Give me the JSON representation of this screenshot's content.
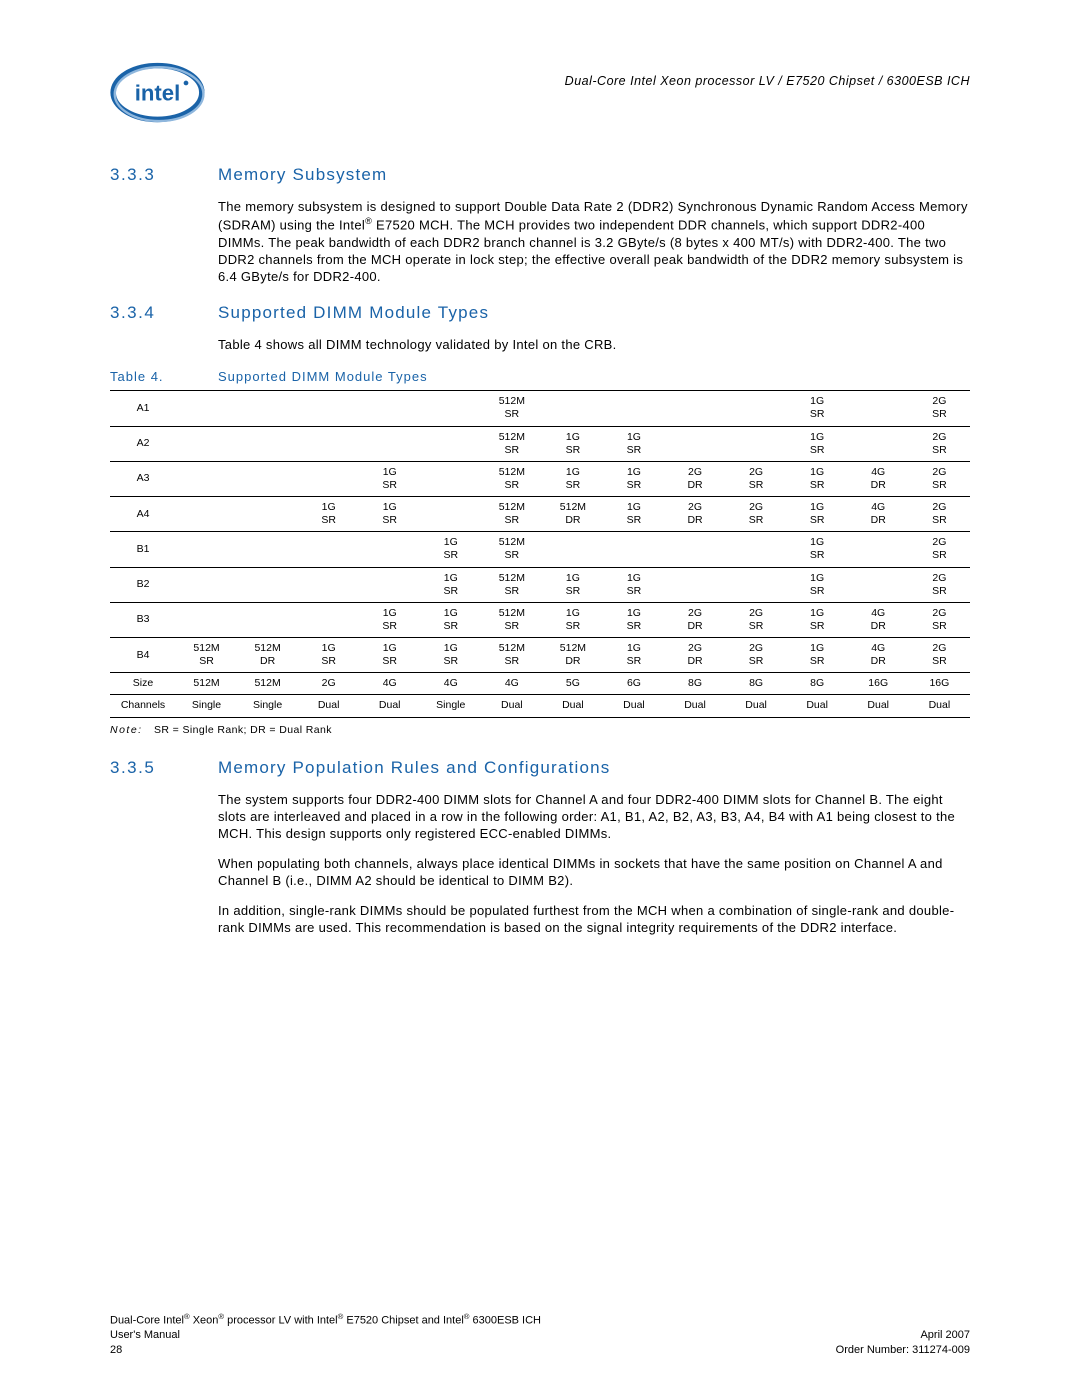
{
  "header": {
    "doc_title": "Dual-Core Intel Xeon processor LV / E7520 Chipset / 6300ESB ICH"
  },
  "sections": {
    "s333": {
      "num": "3.3.3",
      "title": "Memory Subsystem",
      "p1a": "The memory subsystem is designed to support Double Data Rate 2 (DDR2) Synchronous Dynamic Random Access Memory (SDRAM) using the Intel",
      "p1b": " E7520 MCH. The MCH provides two independent DDR channels, which support DDR2-400 DIMMs. The peak bandwidth of each DDR2 branch channel is 3.2 GByte/s (8 bytes x 400 MT/s) with DDR2-400. The two DDR2 channels from the MCH operate in lock step; the effective overall peak bandwidth of the DDR2 memory subsystem is 6.4 GByte/s for DDR2-400."
    },
    "s334": {
      "num": "3.3.4",
      "title": "Supported DIMM Module Types",
      "p1": "Table 4 shows all DIMM technology validated by Intel on the CRB."
    },
    "s335": {
      "num": "3.3.5",
      "title": "Memory Population Rules and Configurations",
      "p1": "The system supports four DDR2-400 DIMM slots for Channel A and four DDR2-400 DIMM slots for Channel B. The eight slots are interleaved and placed in a row in the following order: A1, B1, A2, B2, A3, B3, A4, B4 with A1 being closest to the MCH. This design supports only registered ECC-enabled DIMMs.",
      "p2": "When populating both channels, always place identical DIMMs in sockets that have the same position on Channel A and Channel B (i.e., DIMM A2 should be identical to DIMM B2).",
      "p3": "In addition, single-rank DIMMs should be populated furthest from the MCH when a combination of single-rank and double-rank DIMMs are used. This recommendation is based on the signal integrity requirements of the DDR2 interface."
    }
  },
  "table4": {
    "label": "Table 4.",
    "title": "Supported DIMM Module Types",
    "note_word": "Note:",
    "note_text": "SR = Single Rank; DR = Dual Rank",
    "rows": [
      {
        "label": "A1",
        "c": [
          "",
          "",
          "",
          "",
          "",
          "512M SR",
          "",
          "",
          "",
          "",
          "1G SR",
          "",
          "2G SR"
        ]
      },
      {
        "label": "A2",
        "c": [
          "",
          "",
          "",
          "",
          "",
          "512M SR",
          "1G SR",
          "1G SR",
          "",
          "",
          "1G SR",
          "",
          "2G SR"
        ]
      },
      {
        "label": "A3",
        "c": [
          "",
          "",
          "",
          "1G SR",
          "",
          "512M SR",
          "1G SR",
          "1G SR",
          "2G DR",
          "2G SR",
          "1G SR",
          "4G DR",
          "2G SR"
        ]
      },
      {
        "label": "A4",
        "c": [
          "",
          "",
          "1G SR",
          "1G SR",
          "",
          "512M SR",
          "512M DR",
          "1G SR",
          "2G DR",
          "2G SR",
          "1G SR",
          "4G DR",
          "2G SR"
        ]
      },
      {
        "label": "B1",
        "c": [
          "",
          "",
          "",
          "",
          "1G SR",
          "512M SR",
          "",
          "",
          "",
          "",
          "1G SR",
          "",
          "2G SR"
        ]
      },
      {
        "label": "B2",
        "c": [
          "",
          "",
          "",
          "",
          "1G SR",
          "512M SR",
          "1G SR",
          "1G SR",
          "",
          "",
          "1G SR",
          "",
          "2G SR"
        ]
      },
      {
        "label": "B3",
        "c": [
          "",
          "",
          "",
          "1G SR",
          "1G SR",
          "512M SR",
          "1G SR",
          "1G SR",
          "2G DR",
          "2G SR",
          "1G SR",
          "4G DR",
          "2G SR"
        ]
      },
      {
        "label": "B4",
        "c": [
          "512M SR",
          "512M DR",
          "1G SR",
          "1G SR",
          "1G SR",
          "512M SR",
          "512M DR",
          "1G SR",
          "2G DR",
          "2G SR",
          "1G SR",
          "4G DR",
          "2G SR"
        ]
      },
      {
        "label": "Size",
        "c": [
          "512M",
          "512M",
          "2G",
          "4G",
          "4G",
          "4G",
          "5G",
          "6G",
          "8G",
          "8G",
          "8G",
          "16G",
          "16G"
        ]
      },
      {
        "label": "Channels",
        "c": [
          "Single",
          "Single",
          "Dual",
          "Dual",
          "Single",
          "Dual",
          "Dual",
          "Dual",
          "Dual",
          "Dual",
          "Dual",
          "Dual",
          "Dual"
        ]
      }
    ]
  },
  "footer": {
    "l1a": "Dual-Core Intel",
    "l1b": " Xeon",
    "l1c": " processor LV with Intel",
    "l1d": " E7520 Chipset and Intel",
    "l1e": " 6300ESB ICH",
    "l2_left": "User's Manual",
    "l2_right": "April 2007",
    "l3_left": "28",
    "l3_right": "Order Number: 311274-009"
  },
  "reg_mark": "®"
}
